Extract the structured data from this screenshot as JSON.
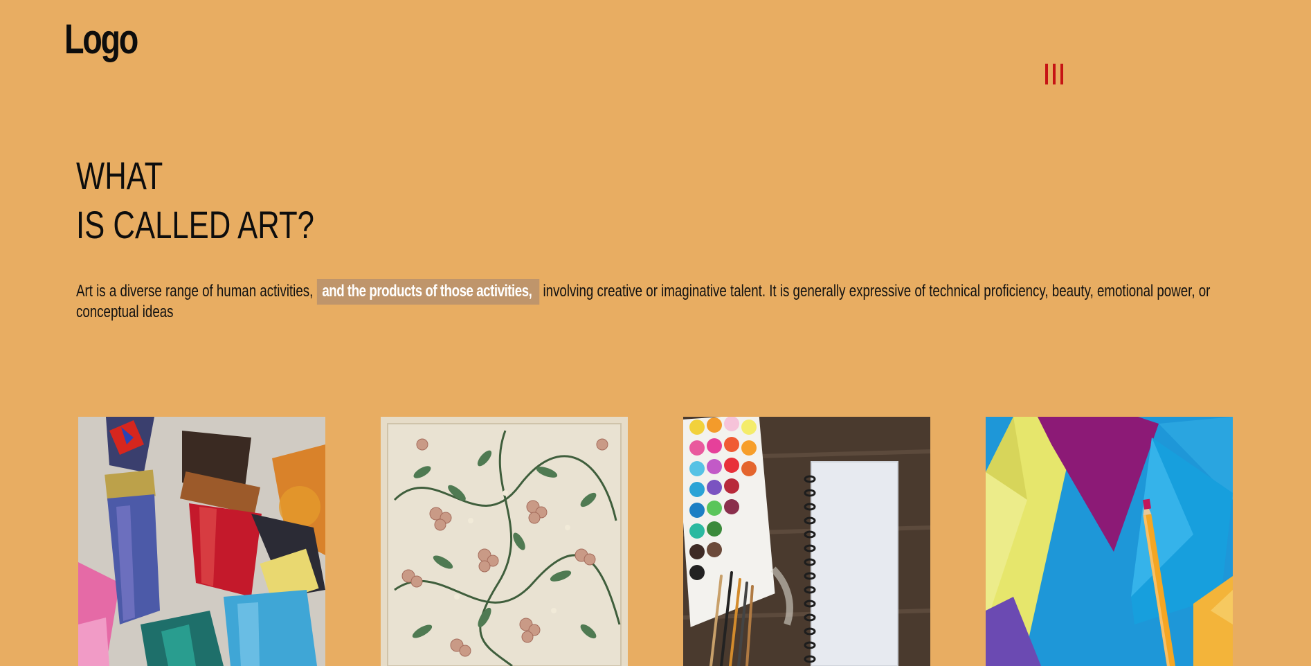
{
  "header": {
    "logo": "Logo",
    "menu_icon": "menu-bars-icon",
    "menu_color": "#c61414"
  },
  "hero": {
    "title_line1": "WHAT",
    "title_line2": "IS CALLED ART?",
    "intro_before": "Art is a diverse range of human activities,",
    "intro_highlight": "and the products of those activities,",
    "intro_after": "involving creative or imaginative talent. It is generally expressive of technical proficiency, beauty, emotional power, or conceptual ideas"
  },
  "gallery": {
    "images": [
      {
        "icon": "paint-brushes-image"
      },
      {
        "icon": "floral-pattern-image"
      },
      {
        "icon": "watercolor-palette-notebook-image"
      },
      {
        "icon": "envelopes-pencil-image"
      }
    ]
  },
  "colors": {
    "background": "#e8ad62",
    "highlight_bg": "#bf956b",
    "text": "#111111"
  }
}
